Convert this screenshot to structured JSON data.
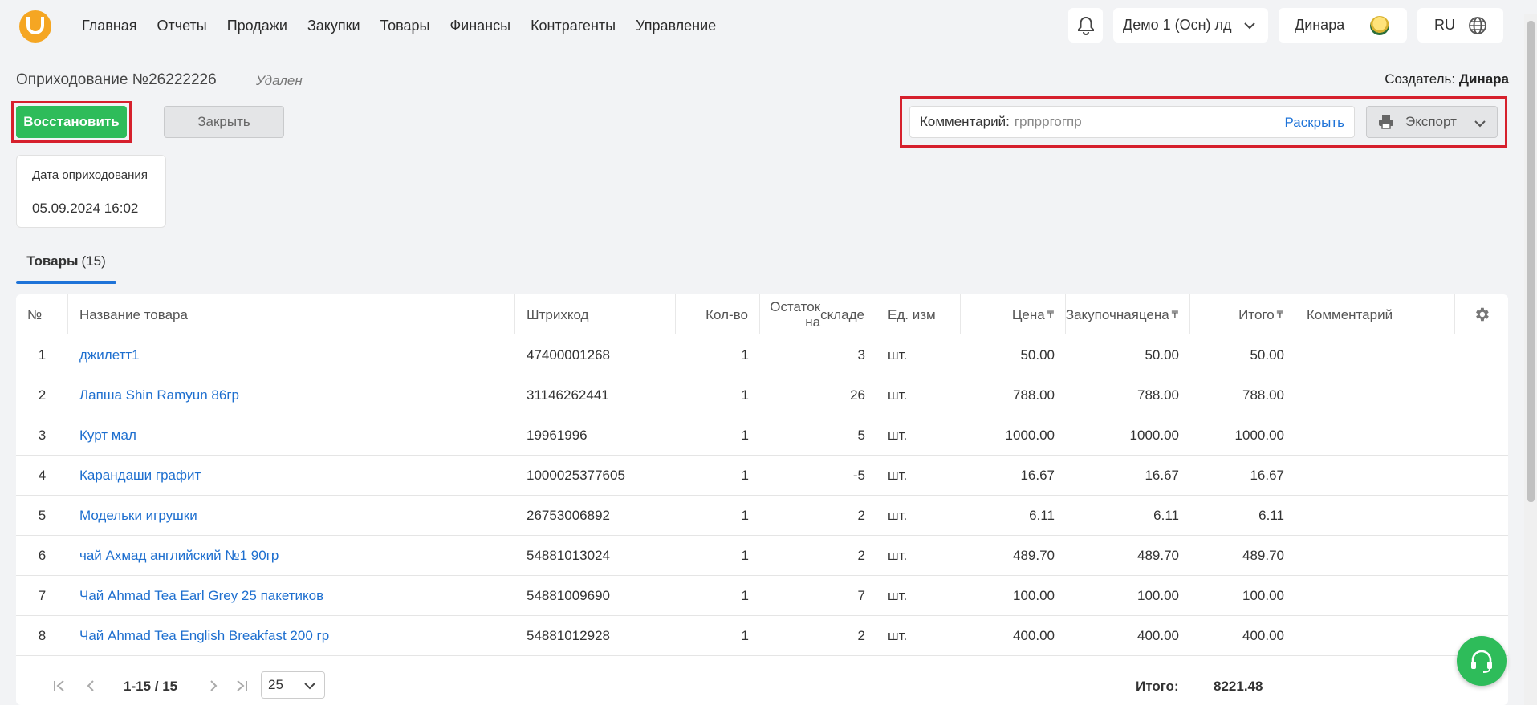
{
  "nav": {
    "menu": [
      "Главная",
      "Отчеты",
      "Продажи",
      "Закупки",
      "Товары",
      "Финансы",
      "Контрагенты",
      "Управление"
    ],
    "company": "Демо 1 (Осн) лд",
    "user": "Динара",
    "lang": "RU"
  },
  "doc": {
    "title": "Оприходование №26222226",
    "status": "Удален",
    "creator_label": "Создатель:",
    "creator": "Динара",
    "restore_label": "Восстановить",
    "close_label": "Закрыть",
    "comment_label": "Комментарий:",
    "comment_value": "грпрргогпр",
    "expand_label": "Раскрыть",
    "export_label": "Экспорт",
    "date_label": "Дата оприходования",
    "date_value": "05.09.2024 16:02"
  },
  "tab": {
    "label": "Товары",
    "count": "(15)"
  },
  "table": {
    "headers": {
      "num": "№",
      "name": "Название товара",
      "barcode": "Штрихкод",
      "qty": "Кол-во",
      "stock_1": "Остаток на",
      "stock_2": "складе",
      "unit": "Ед. изм",
      "price": "Цена",
      "purchase_1": "Закупочная",
      "purchase_2": "цена",
      "total": "Итого",
      "comment": "Комментарий",
      "currency": "₸"
    },
    "rows": [
      {
        "num": "1",
        "name": "джилетт1",
        "barcode": "47400001268",
        "qty": "1",
        "stock": "3",
        "unit": "шт.",
        "price": "50.00",
        "purchase": "50.00",
        "total": "50.00"
      },
      {
        "num": "2",
        "name": "Лапша Shin Ramyun 86гр",
        "barcode": "31146262441",
        "qty": "1",
        "stock": "26",
        "unit": "шт.",
        "price": "788.00",
        "purchase": "788.00",
        "total": "788.00"
      },
      {
        "num": "3",
        "name": "Курт мал",
        "barcode": "19961996",
        "qty": "1",
        "stock": "5",
        "unit": "шт.",
        "price": "1000.00",
        "purchase": "1000.00",
        "total": "1000.00"
      },
      {
        "num": "4",
        "name": "Карандаши графит",
        "barcode": "1000025377605",
        "qty": "1",
        "stock": "-5",
        "unit": "шт.",
        "price": "16.67",
        "purchase": "16.67",
        "total": "16.67"
      },
      {
        "num": "5",
        "name": "Модельки игрушки",
        "barcode": "26753006892",
        "qty": "1",
        "stock": "2",
        "unit": "шт.",
        "price": "6.11",
        "purchase": "6.11",
        "total": "6.11"
      },
      {
        "num": "6",
        "name": "чай Ахмад английский №1 90гр",
        "barcode": "54881013024",
        "qty": "1",
        "stock": "2",
        "unit": "шт.",
        "price": "489.70",
        "purchase": "489.70",
        "total": "489.70"
      },
      {
        "num": "7",
        "name": "Чай Ahmad Tea Earl Grey 25 пакетиков",
        "barcode": "54881009690",
        "qty": "1",
        "stock": "7",
        "unit": "шт.",
        "price": "100.00",
        "purchase": "100.00",
        "total": "100.00"
      },
      {
        "num": "8",
        "name": "Чай Ahmad Tea English Breakfast 200 гр",
        "barcode": "54881012928",
        "qty": "1",
        "stock": "2",
        "unit": "шт.",
        "price": "400.00",
        "purchase": "400.00",
        "total": "400.00"
      }
    ]
  },
  "pager": {
    "range": "1-15 / 15",
    "page_size": "25",
    "total_label": "Итого:",
    "total_value": "8221.48"
  },
  "colors": {
    "accent": "#2ebc5a",
    "link": "#1e6fcf",
    "highlight": "#d6202c",
    "logo": "#f5a623"
  }
}
